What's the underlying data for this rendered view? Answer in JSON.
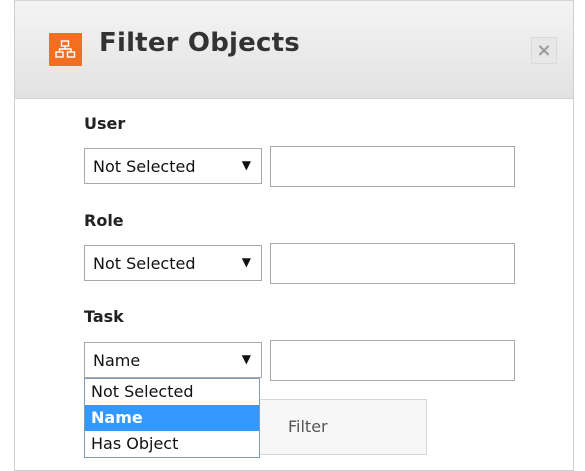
{
  "dialog": {
    "title": "Filter Objects",
    "header_icon": "hierarchy-icon",
    "close_label": "×",
    "accent_color": "#f26f21"
  },
  "fields": {
    "user": {
      "label": "User",
      "select_value": "Not Selected",
      "input_value": ""
    },
    "role": {
      "label": "Role",
      "select_value": "Not Selected",
      "input_value": ""
    },
    "task": {
      "label": "Task",
      "select_value": "Name",
      "input_value": ""
    }
  },
  "dropdown": {
    "options": [
      "Not Selected",
      "Name",
      "Has Object"
    ],
    "selected": "Name"
  },
  "filter_button": {
    "label": "Filter"
  }
}
